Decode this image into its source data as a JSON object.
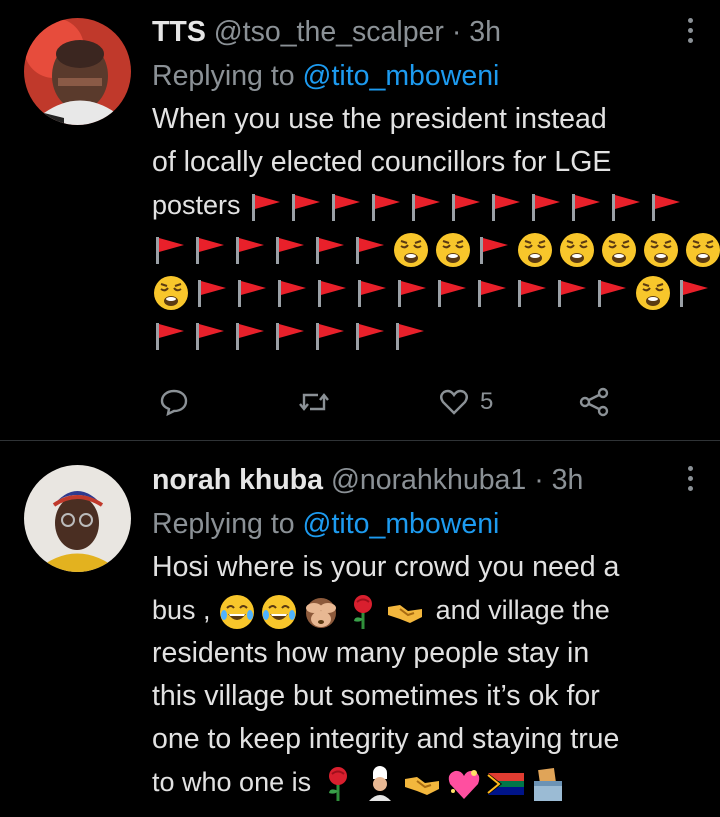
{
  "tweets": [
    {
      "name": "TTS",
      "handle": "@tso_the_scalper",
      "separator": "·",
      "time": "3h",
      "replying_prefix": "Replying to",
      "replying_to": "@tito_mboweni",
      "text_lines": [
        "When you use the president instead",
        "of locally elected councillors for LGE",
        "posters"
      ],
      "emoji_rows": [
        [
          "red-flag",
          "red-flag",
          "red-flag",
          "red-flag",
          "red-flag",
          "red-flag",
          "red-flag",
          "red-flag",
          "red-flag",
          "red-flag",
          "red-flag"
        ],
        [
          "red-flag",
          "red-flag",
          "red-flag",
          "red-flag",
          "red-flag",
          "red-flag",
          "weary-face",
          "weary-face",
          "red-flag",
          "weary-face",
          "weary-face",
          "weary-face",
          "weary-face",
          "weary-face"
        ],
        [
          "weary-face",
          "red-flag",
          "red-flag",
          "red-flag",
          "red-flag",
          "red-flag",
          "red-flag",
          "red-flag",
          "red-flag",
          "red-flag",
          "red-flag",
          "red-flag",
          "weary-face",
          "red-flag"
        ],
        [
          "red-flag",
          "red-flag",
          "red-flag",
          "red-flag",
          "red-flag",
          "red-flag",
          "red-flag"
        ]
      ],
      "actions": {
        "like_count": "5"
      }
    },
    {
      "name": "norah khuba",
      "handle": "@norahkhuba1",
      "separator": "·",
      "time": "3h",
      "replying_prefix": "Replying to",
      "replying_to": "@tito_mboweni",
      "lines": {
        "l1": "Hosi where is your crowd you need a",
        "l2_start": "bus ,",
        "l2_end": "and village the",
        "l3": "residents how many people stay in",
        "l4": "this village but sometimes it’s  ok for",
        "l5": "one to keep integrity and staying true",
        "l6_start": "to who one is"
      },
      "emoji_line2": [
        "joy-face",
        "joy-face",
        "see-no-evil-monkey",
        "rose",
        "handshake"
      ],
      "emoji_line6": [
        "rose",
        "cook",
        "handshake",
        "sparkling-heart",
        "south-africa-flag",
        "ballot-box"
      ]
    }
  ],
  "colors": {
    "background": "#000000",
    "text": "#e2e2e2",
    "muted": "#8b9196",
    "link": "#1d9bf0",
    "divider": "#2f3336"
  },
  "icons": {
    "reply": "comment-bubble-icon",
    "retweet": "retweet-icon",
    "like": "heart-icon",
    "share": "share-icon",
    "more": "more-vertical-icon"
  }
}
